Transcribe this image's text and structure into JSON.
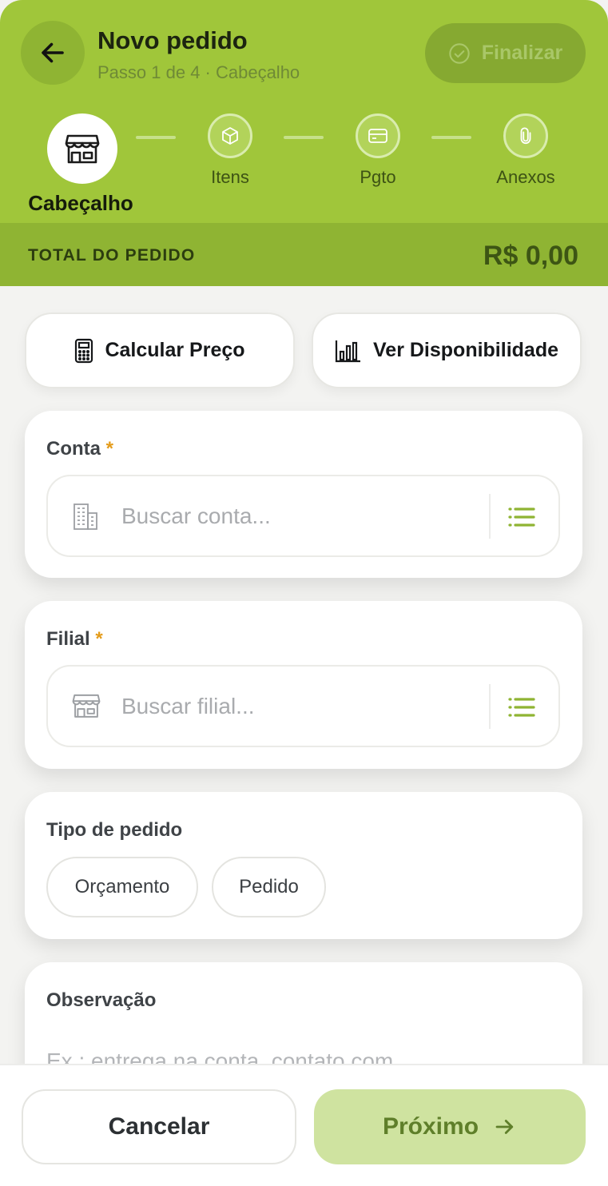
{
  "header": {
    "title": "Novo pedido",
    "subtitle": "Passo 1 de 4 · Cabeçalho",
    "finalize_label": "Finalizar"
  },
  "steps": [
    {
      "label": "Cabeçalho",
      "icon": "store-icon",
      "state": "active"
    },
    {
      "label": "Itens",
      "icon": "box-icon",
      "state": "pending"
    },
    {
      "label": "Pgto",
      "icon": "card-icon",
      "state": "pending"
    },
    {
      "label": "Anexos",
      "icon": "paperclip-icon",
      "state": "pending"
    }
  ],
  "total": {
    "label": "TOTAL DO PEDIDO",
    "value": "R$ 0,00"
  },
  "actions": {
    "calc_label": "Calcular Preço",
    "availability_label": "Ver Disponibilidade"
  },
  "conta": {
    "label": "Conta",
    "required_mark": "*",
    "placeholder": "Buscar conta..."
  },
  "filial": {
    "label": "Filial",
    "required_mark": "*",
    "placeholder": "Buscar filial..."
  },
  "tipo": {
    "label": "Tipo de pedido",
    "options": [
      "Orçamento",
      "Pedido"
    ]
  },
  "observacao": {
    "label": "Observação",
    "placeholder": "Ex.: entrega na conta, contato com..."
  },
  "footer": {
    "cancel_label": "Cancelar",
    "next_label": "Próximo"
  },
  "colors": {
    "brand": "#a0c63a",
    "brand_dark": "#8fb433",
    "required": "#e49c1b",
    "next_button": "#cfe3a0"
  }
}
